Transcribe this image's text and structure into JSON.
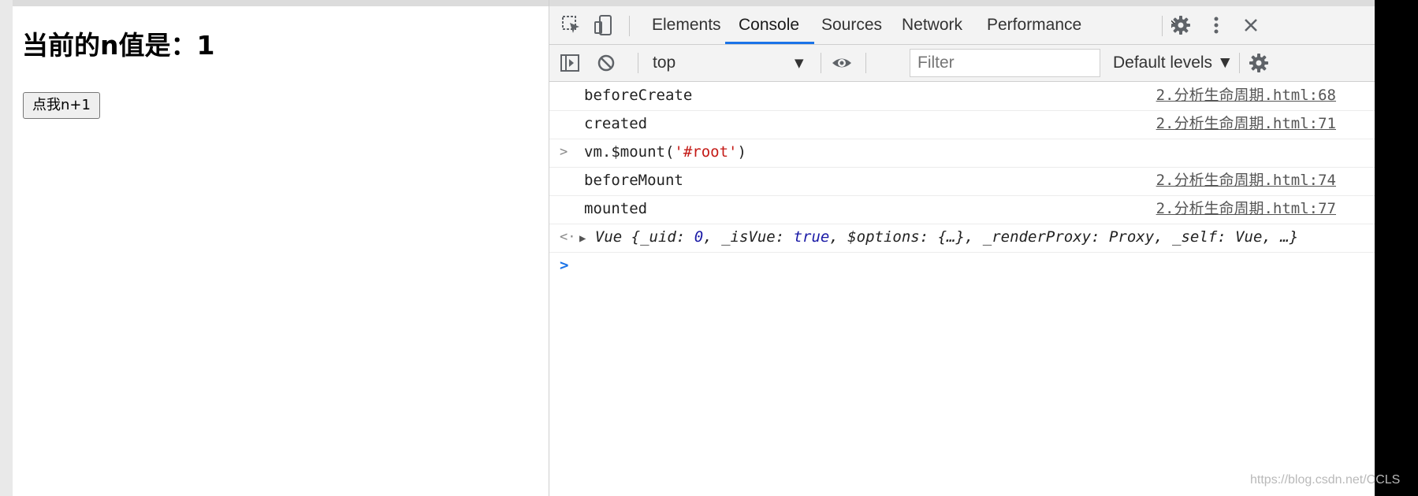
{
  "page": {
    "title": "当前的n值是：1",
    "button_label": "点我n+1"
  },
  "devtools": {
    "tabs": [
      {
        "label": "Elements"
      },
      {
        "label": "Console",
        "active": true
      },
      {
        "label": "Sources"
      },
      {
        "label": "Network"
      },
      {
        "label": "Performance"
      }
    ],
    "more_tabs": "»",
    "toolbar": {
      "context": "top",
      "filter_placeholder": "Filter",
      "levels": "Default levels ▼"
    },
    "console_rows": [
      {
        "message": "beforeCreate",
        "source": "2.分析生命周期.html:68"
      },
      {
        "message": "created",
        "source": "2.分析生命周期.html:71"
      },
      {
        "prefix": ">",
        "input_fn": "vm.$mount(",
        "input_str": "'#root'",
        "input_end": ")"
      },
      {
        "message": "beforeMount",
        "source": "2.分析生命周期.html:74"
      },
      {
        "message": "mounted",
        "source": "2.分析生命周期.html:77"
      },
      {
        "prefix": "<·",
        "result_expand": "▶",
        "result_parts": [
          "Vue {_uid: ",
          "0",
          ", _isVue: ",
          "true",
          ", $options: {…}, _renderProxy: Proxy, _self: Vue, …}"
        ]
      }
    ],
    "prompt": ">"
  },
  "watermark": "https://blog.csdn.net/CCLS",
  "icon_names": [
    "inspect-element-icon",
    "device-toolbar-icon",
    "settings-gear-icon",
    "more-vert-icon",
    "close-icon",
    "sidebar-toggle-icon",
    "clear-console-icon",
    "live-expression-eye-icon",
    "console-settings-gear-icon"
  ],
  "colors": {
    "active_tab_underline": "#1a73e8",
    "string": "#c41a16",
    "keyword": "#1a1aa6",
    "panel_bg": "#f3f3f3"
  }
}
